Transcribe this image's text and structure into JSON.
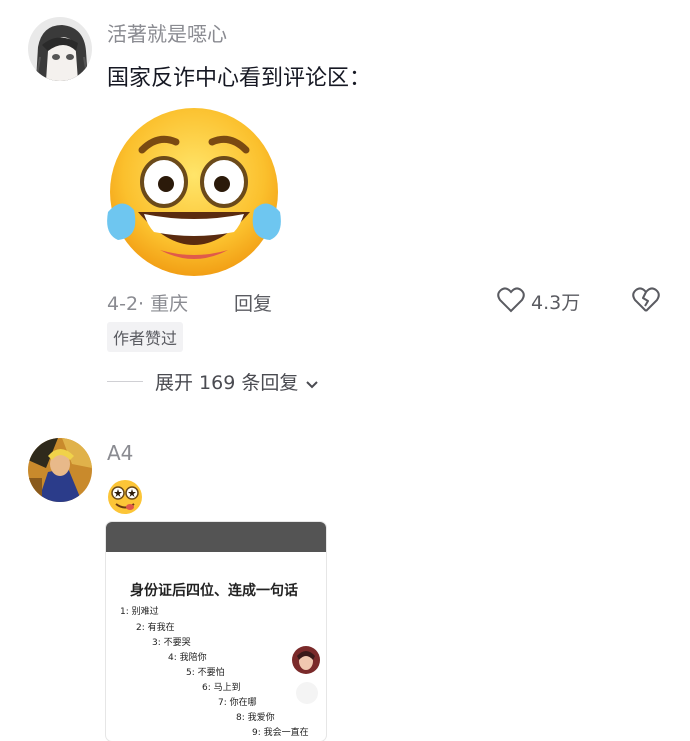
{
  "comment1": {
    "username": "活著就是噁心",
    "text": "国家反诈中心看到评论区：",
    "emoji": "crying-laughing-emoji",
    "date_location": "4-2· 重庆",
    "reply_label": "回复",
    "like_count": "4.3万",
    "author_badge": "作者赞过",
    "expand_label": "展开 169 条回复"
  },
  "comment2": {
    "username": "A4",
    "emoji": "star-eyes-emoji",
    "image": {
      "title": "身份证后四位、连成一句话",
      "steps": [
        "1: 别难过",
        "2: 有我在",
        "3: 不要哭",
        "4: 我陪你",
        "5: 不要怕",
        "6: 马上到",
        "7: 你在哪",
        "8: 我爱你",
        "9: 我会一直在"
      ]
    }
  },
  "colors": {
    "secondary_text": "#8a8b91",
    "primary_text": "#161823",
    "badge_bg": "#f2f2f4"
  }
}
